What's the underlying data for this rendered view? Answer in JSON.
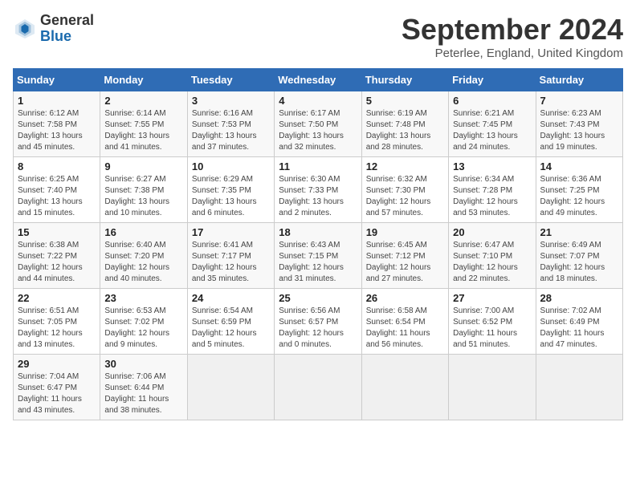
{
  "header": {
    "logo_line1": "General",
    "logo_line2": "Blue",
    "month": "September 2024",
    "location": "Peterlee, England, United Kingdom"
  },
  "weekdays": [
    "Sunday",
    "Monday",
    "Tuesday",
    "Wednesday",
    "Thursday",
    "Friday",
    "Saturday"
  ],
  "weeks": [
    [
      {
        "day": "1",
        "sunrise": "Sunrise: 6:12 AM",
        "sunset": "Sunset: 7:58 PM",
        "daylight": "Daylight: 13 hours and 45 minutes."
      },
      {
        "day": "2",
        "sunrise": "Sunrise: 6:14 AM",
        "sunset": "Sunset: 7:55 PM",
        "daylight": "Daylight: 13 hours and 41 minutes."
      },
      {
        "day": "3",
        "sunrise": "Sunrise: 6:16 AM",
        "sunset": "Sunset: 7:53 PM",
        "daylight": "Daylight: 13 hours and 37 minutes."
      },
      {
        "day": "4",
        "sunrise": "Sunrise: 6:17 AM",
        "sunset": "Sunset: 7:50 PM",
        "daylight": "Daylight: 13 hours and 32 minutes."
      },
      {
        "day": "5",
        "sunrise": "Sunrise: 6:19 AM",
        "sunset": "Sunset: 7:48 PM",
        "daylight": "Daylight: 13 hours and 28 minutes."
      },
      {
        "day": "6",
        "sunrise": "Sunrise: 6:21 AM",
        "sunset": "Sunset: 7:45 PM",
        "daylight": "Daylight: 13 hours and 24 minutes."
      },
      {
        "day": "7",
        "sunrise": "Sunrise: 6:23 AM",
        "sunset": "Sunset: 7:43 PM",
        "daylight": "Daylight: 13 hours and 19 minutes."
      }
    ],
    [
      {
        "day": "8",
        "sunrise": "Sunrise: 6:25 AM",
        "sunset": "Sunset: 7:40 PM",
        "daylight": "Daylight: 13 hours and 15 minutes."
      },
      {
        "day": "9",
        "sunrise": "Sunrise: 6:27 AM",
        "sunset": "Sunset: 7:38 PM",
        "daylight": "Daylight: 13 hours and 10 minutes."
      },
      {
        "day": "10",
        "sunrise": "Sunrise: 6:29 AM",
        "sunset": "Sunset: 7:35 PM",
        "daylight": "Daylight: 13 hours and 6 minutes."
      },
      {
        "day": "11",
        "sunrise": "Sunrise: 6:30 AM",
        "sunset": "Sunset: 7:33 PM",
        "daylight": "Daylight: 13 hours and 2 minutes."
      },
      {
        "day": "12",
        "sunrise": "Sunrise: 6:32 AM",
        "sunset": "Sunset: 7:30 PM",
        "daylight": "Daylight: 12 hours and 57 minutes."
      },
      {
        "day": "13",
        "sunrise": "Sunrise: 6:34 AM",
        "sunset": "Sunset: 7:28 PM",
        "daylight": "Daylight: 12 hours and 53 minutes."
      },
      {
        "day": "14",
        "sunrise": "Sunrise: 6:36 AM",
        "sunset": "Sunset: 7:25 PM",
        "daylight": "Daylight: 12 hours and 49 minutes."
      }
    ],
    [
      {
        "day": "15",
        "sunrise": "Sunrise: 6:38 AM",
        "sunset": "Sunset: 7:22 PM",
        "daylight": "Daylight: 12 hours and 44 minutes."
      },
      {
        "day": "16",
        "sunrise": "Sunrise: 6:40 AM",
        "sunset": "Sunset: 7:20 PM",
        "daylight": "Daylight: 12 hours and 40 minutes."
      },
      {
        "day": "17",
        "sunrise": "Sunrise: 6:41 AM",
        "sunset": "Sunset: 7:17 PM",
        "daylight": "Daylight: 12 hours and 35 minutes."
      },
      {
        "day": "18",
        "sunrise": "Sunrise: 6:43 AM",
        "sunset": "Sunset: 7:15 PM",
        "daylight": "Daylight: 12 hours and 31 minutes."
      },
      {
        "day": "19",
        "sunrise": "Sunrise: 6:45 AM",
        "sunset": "Sunset: 7:12 PM",
        "daylight": "Daylight: 12 hours and 27 minutes."
      },
      {
        "day": "20",
        "sunrise": "Sunrise: 6:47 AM",
        "sunset": "Sunset: 7:10 PM",
        "daylight": "Daylight: 12 hours and 22 minutes."
      },
      {
        "day": "21",
        "sunrise": "Sunrise: 6:49 AM",
        "sunset": "Sunset: 7:07 PM",
        "daylight": "Daylight: 12 hours and 18 minutes."
      }
    ],
    [
      {
        "day": "22",
        "sunrise": "Sunrise: 6:51 AM",
        "sunset": "Sunset: 7:05 PM",
        "daylight": "Daylight: 12 hours and 13 minutes."
      },
      {
        "day": "23",
        "sunrise": "Sunrise: 6:53 AM",
        "sunset": "Sunset: 7:02 PM",
        "daylight": "Daylight: 12 hours and 9 minutes."
      },
      {
        "day": "24",
        "sunrise": "Sunrise: 6:54 AM",
        "sunset": "Sunset: 6:59 PM",
        "daylight": "Daylight: 12 hours and 5 minutes."
      },
      {
        "day": "25",
        "sunrise": "Sunrise: 6:56 AM",
        "sunset": "Sunset: 6:57 PM",
        "daylight": "Daylight: 12 hours and 0 minutes."
      },
      {
        "day": "26",
        "sunrise": "Sunrise: 6:58 AM",
        "sunset": "Sunset: 6:54 PM",
        "daylight": "Daylight: 11 hours and 56 minutes."
      },
      {
        "day": "27",
        "sunrise": "Sunrise: 7:00 AM",
        "sunset": "Sunset: 6:52 PM",
        "daylight": "Daylight: 11 hours and 51 minutes."
      },
      {
        "day": "28",
        "sunrise": "Sunrise: 7:02 AM",
        "sunset": "Sunset: 6:49 PM",
        "daylight": "Daylight: 11 hours and 47 minutes."
      }
    ],
    [
      {
        "day": "29",
        "sunrise": "Sunrise: 7:04 AM",
        "sunset": "Sunset: 6:47 PM",
        "daylight": "Daylight: 11 hours and 43 minutes."
      },
      {
        "day": "30",
        "sunrise": "Sunrise: 7:06 AM",
        "sunset": "Sunset: 6:44 PM",
        "daylight": "Daylight: 11 hours and 38 minutes."
      },
      null,
      null,
      null,
      null,
      null
    ]
  ]
}
